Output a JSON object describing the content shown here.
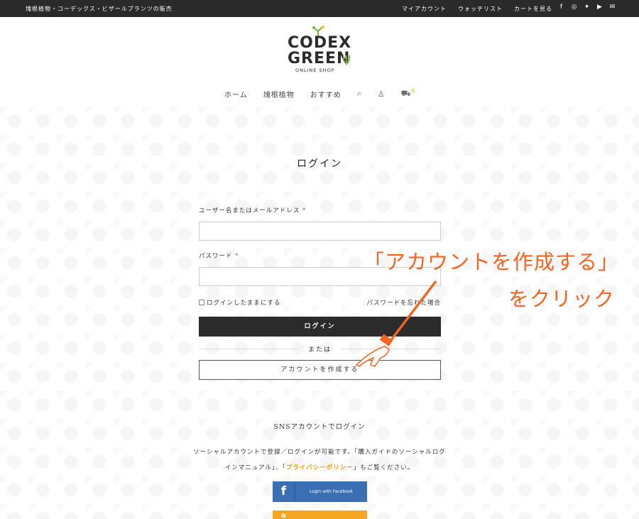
{
  "topbar": {
    "tagline": "塊根植物・コーデックス・ビザールプランツの販売",
    "links": [
      "マイアカウント",
      "ウォッチリスト",
      "カートを見る"
    ],
    "social_icons": [
      "facebook-icon",
      "instagram-icon",
      "twitter-icon",
      "youtube-icon",
      "mail-icon"
    ]
  },
  "logo": {
    "line1": "CODEX",
    "line2": "GREEN",
    "line3": "ONLINE SHOP"
  },
  "nav": {
    "items": [
      "ホーム",
      "塊根植物",
      "おすすめ"
    ],
    "cart_count": "0"
  },
  "page_title": "ログイン",
  "form": {
    "username_label": "ユーザー名またはメールアドレス",
    "password_label": "パスワード",
    "required_mark": "*",
    "remember_label": "ログインしたままにする",
    "forgot_password": "パスワードを忘れた場合",
    "login_button": "ログイン",
    "or_text": "または",
    "create_account_button": "アカウントを作成する"
  },
  "sns": {
    "title": "SNSアカウントでログイン",
    "desc_part1": "ソーシャルアカウントで登録／ログインが可能です。「購入ガイドのソーシャルログインマニュアル」、「",
    "desc_link": "プライバシーポリシー",
    "desc_part2": "」もご覧ください。",
    "facebook_button": "Login with Facebook"
  },
  "annotation": {
    "line1": "「アカウントを作成する」",
    "line2": "をクリック",
    "color": "#f26522"
  }
}
